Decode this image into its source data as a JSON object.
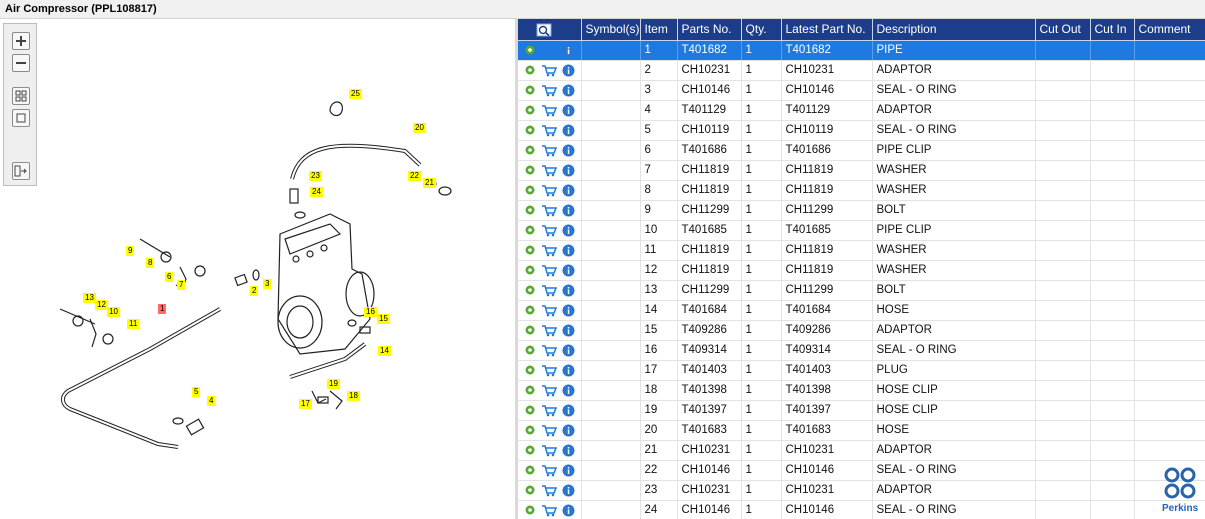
{
  "window": {
    "title": "Air Compressor (PPL108817)"
  },
  "toolbar": {
    "buttons": [
      "zoom-in",
      "zoom-out",
      "fit-page",
      "actual-size",
      "export"
    ]
  },
  "table": {
    "headers": [
      "Symbol(s)",
      "Item",
      "Parts No.",
      "Qty.",
      "Latest Part No.",
      "Description",
      "Cut Out",
      "Cut In",
      "Comment"
    ],
    "rows": [
      {
        "item": "1",
        "part": "T401682",
        "qty": "1",
        "latest": "T401682",
        "desc": "PIPE",
        "selected": true
      },
      {
        "item": "2",
        "part": "CH10231",
        "qty": "1",
        "latest": "CH10231",
        "desc": "ADAPTOR"
      },
      {
        "item": "3",
        "part": "CH10146",
        "qty": "1",
        "latest": "CH10146",
        "desc": "SEAL - O RING"
      },
      {
        "item": "4",
        "part": "T401129",
        "qty": "1",
        "latest": "T401129",
        "desc": "ADAPTOR"
      },
      {
        "item": "5",
        "part": "CH10119",
        "qty": "1",
        "latest": "CH10119",
        "desc": "SEAL - O RING"
      },
      {
        "item": "6",
        "part": "T401686",
        "qty": "1",
        "latest": "T401686",
        "desc": "PIPE CLIP"
      },
      {
        "item": "7",
        "part": "CH11819",
        "qty": "1",
        "latest": "CH11819",
        "desc": "WASHER"
      },
      {
        "item": "8",
        "part": "CH11819",
        "qty": "1",
        "latest": "CH11819",
        "desc": "WASHER"
      },
      {
        "item": "9",
        "part": "CH11299",
        "qty": "1",
        "latest": "CH11299",
        "desc": "BOLT"
      },
      {
        "item": "10",
        "part": "T401685",
        "qty": "1",
        "latest": "T401685",
        "desc": "PIPE CLIP"
      },
      {
        "item": "11",
        "part": "CH11819",
        "qty": "1",
        "latest": "CH11819",
        "desc": "WASHER"
      },
      {
        "item": "12",
        "part": "CH11819",
        "qty": "1",
        "latest": "CH11819",
        "desc": "WASHER"
      },
      {
        "item": "13",
        "part": "CH11299",
        "qty": "1",
        "latest": "CH11299",
        "desc": "BOLT"
      },
      {
        "item": "14",
        "part": "T401684",
        "qty": "1",
        "latest": "T401684",
        "desc": "HOSE"
      },
      {
        "item": "15",
        "part": "T409286",
        "qty": "1",
        "latest": "T409286",
        "desc": "ADAPTOR"
      },
      {
        "item": "16",
        "part": "T409314",
        "qty": "1",
        "latest": "T409314",
        "desc": "SEAL - O RING"
      },
      {
        "item": "17",
        "part": "T401403",
        "qty": "1",
        "latest": "T401403",
        "desc": "PLUG"
      },
      {
        "item": "18",
        "part": "T401398",
        "qty": "1",
        "latest": "T401398",
        "desc": "HOSE CLIP"
      },
      {
        "item": "19",
        "part": "T401397",
        "qty": "1",
        "latest": "T401397",
        "desc": "HOSE CLIP"
      },
      {
        "item": "20",
        "part": "T401683",
        "qty": "1",
        "latest": "T401683",
        "desc": "HOSE"
      },
      {
        "item": "21",
        "part": "CH10231",
        "qty": "1",
        "latest": "CH10231",
        "desc": "ADAPTOR"
      },
      {
        "item": "22",
        "part": "CH10146",
        "qty": "1",
        "latest": "CH10146",
        "desc": "SEAL - O RING"
      },
      {
        "item": "23",
        "part": "CH10231",
        "qty": "1",
        "latest": "CH10231",
        "desc": "ADAPTOR"
      },
      {
        "item": "24",
        "part": "CH10146",
        "qty": "1",
        "latest": "CH10146",
        "desc": "SEAL - O RING"
      }
    ]
  },
  "diagram": {
    "callouts": [
      "1",
      "2",
      "3",
      "4",
      "5",
      "6",
      "7",
      "8",
      "9",
      "10",
      "11",
      "12",
      "13",
      "14",
      "15",
      "16",
      "17",
      "18",
      "19",
      "20",
      "21",
      "22",
      "23",
      "24",
      "25"
    ],
    "highlighted_callout": "1"
  },
  "logo": {
    "text": "Perkins",
    "color": "#2864ac"
  },
  "colors": {
    "header_bg": "#1c3e8a",
    "selected_row": "#1e7ae0",
    "callout": "#ffff00",
    "callout_highlight": "#ff6b6b"
  }
}
